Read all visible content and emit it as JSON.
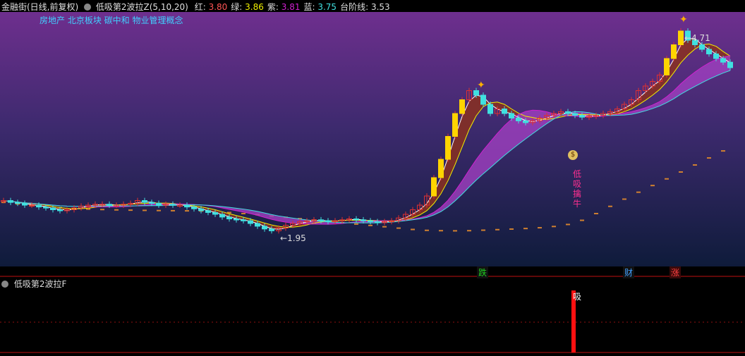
{
  "header": {
    "app_title": "金融街(日线,前复权)",
    "indicator_name": "低吸第2波拉Z(5,10,20)",
    "legend": [
      {
        "label": "红:",
        "value": "3.80",
        "color": "#ff5555"
      },
      {
        "label": "绿:",
        "value": "3.86",
        "color": "#f0f000"
      },
      {
        "label": "紫:",
        "value": "3.81",
        "color": "#d020d0"
      },
      {
        "label": "蓝:",
        "value": "3.75",
        "color": "#40e0e0"
      },
      {
        "label": "台阶线:",
        "value": "3.53",
        "color": "#dddddd"
      }
    ]
  },
  "concepts": "房地产 北京板块 碳中和 物业管理概念",
  "price_high_label": "4.71",
  "price_low_label": "1.95",
  "signal_text": [
    "低",
    "吸",
    "擒",
    "牛"
  ],
  "event_markers": [
    {
      "label": "跌",
      "color": "#20d020"
    },
    {
      "label": "财",
      "color": "#40a0ff"
    },
    {
      "label": "涨",
      "color": "#ff4040"
    }
  ],
  "sub_panel": {
    "title": "低吸第2波拉F",
    "bar_label": "吸"
  },
  "colors": {
    "bg_top": "#6a2e8a",
    "bg_bottom": "#0f1c3c",
    "up": "#e03030",
    "down": "#40e0e0",
    "accent_yellow": "#ffd400",
    "ribbon_brown": "#8a3020",
    "ribbon_purple": "#a040c0",
    "step_line": "#d08030"
  },
  "chart_data": {
    "type": "line",
    "x": [
      0,
      1,
      2,
      3,
      4,
      5,
      6,
      7,
      8,
      9,
      10,
      11,
      12,
      13,
      14,
      15,
      16,
      17,
      18,
      19,
      20,
      21,
      22,
      23,
      24,
      25,
      26,
      27,
      28,
      29,
      30,
      31,
      32,
      33,
      34,
      35,
      36,
      37,
      38,
      39,
      40,
      41,
      42,
      43,
      44,
      45,
      46,
      47,
      48,
      49,
      50,
      51,
      52,
      53,
      54,
      55,
      56,
      57,
      58,
      59,
      60,
      61,
      62,
      63,
      64,
      65,
      66,
      67,
      68,
      69,
      70,
      71,
      72,
      73,
      74,
      75,
      76,
      77,
      78,
      79,
      80,
      81,
      82,
      83,
      84,
      85,
      86,
      87,
      88,
      89,
      90,
      91,
      92,
      93,
      94,
      95,
      96,
      97,
      98,
      99,
      100,
      101,
      102,
      103
    ],
    "series": [
      {
        "values": [
          2.35,
          2.33,
          2.32,
          2.3,
          2.3,
          2.28,
          2.27,
          2.25,
          2.24,
          2.25,
          2.27,
          2.29,
          2.3,
          2.31,
          2.31,
          2.3,
          2.3,
          2.31,
          2.32,
          2.35,
          2.33,
          2.32,
          2.3,
          2.31,
          2.3,
          2.3,
          2.28,
          2.26,
          2.24,
          2.22,
          2.2,
          2.17,
          2.15,
          2.14,
          2.13,
          2.1,
          2.07,
          2.04,
          2.02,
          2.05,
          2.08,
          2.1,
          2.12,
          2.13,
          2.14,
          2.13,
          2.12,
          2.13,
          2.14,
          2.15,
          2.14,
          2.13,
          2.12,
          2.11,
          2.12,
          2.13,
          2.16,
          2.2,
          2.25,
          2.3,
          2.4,
          2.6,
          2.8,
          3.05,
          3.3,
          3.45,
          3.55,
          3.5,
          3.4,
          3.3,
          3.35,
          3.3,
          3.25,
          3.22,
          3.2,
          3.22,
          3.25,
          3.28,
          3.3,
          3.32,
          3.3,
          3.28,
          3.26,
          3.27,
          3.28,
          3.3,
          3.32,
          3.35,
          3.4,
          3.45,
          3.55,
          3.6,
          3.65,
          3.72,
          3.9,
          4.05,
          4.2,
          4.1,
          4.05,
          4.0,
          3.95,
          3.9,
          3.86,
          3.8
        ]
      }
    ]
  }
}
